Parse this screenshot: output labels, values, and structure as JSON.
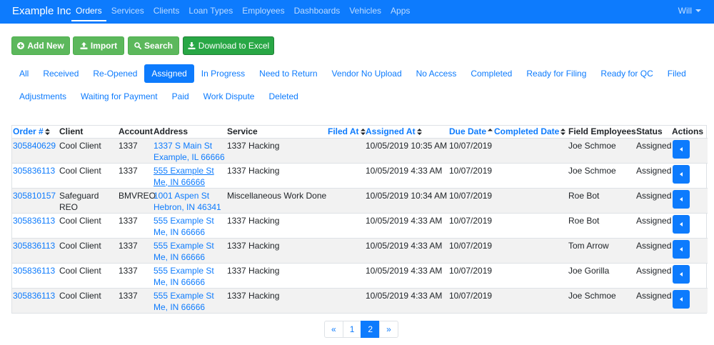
{
  "brand": "Example Inc",
  "nav": [
    "Orders",
    "Services",
    "Clients",
    "Loan Types",
    "Employees",
    "Dashboards",
    "Vehicles",
    "Apps"
  ],
  "nav_active": 0,
  "user": "Will",
  "toolbar": {
    "add_new": "Add New",
    "import": "Import",
    "search": "Search",
    "download": "Download to Excel"
  },
  "filters_row1": [
    "All",
    "Received",
    "Re-Opened",
    "Assigned",
    "In Progress",
    "Need to Return",
    "Vendor No Upload",
    "No Access",
    "Completed",
    "Ready for Filing",
    "Ready for QC",
    "Filed"
  ],
  "filters_row2": [
    "Adjustments",
    "Waiting for Payment",
    "Paid",
    "Work Dispute",
    "Deleted"
  ],
  "filter_active": "Assigned",
  "columns": {
    "order": "Order #",
    "client": "Client",
    "account": "Account",
    "address": "Address",
    "service": "Service",
    "filed_at": "Filed At",
    "assigned_at": "Assigned At",
    "due_date": "Due Date",
    "completed_date": "Completed Date",
    "field_employees": "Field Employees",
    "status": "Status",
    "actions": "Actions"
  },
  "rows": [
    {
      "order": "305840629",
      "client": "Cool Client",
      "account": "1337",
      "address1": "1337 S Main St",
      "address2": "Example, IL 66666",
      "service": "1337 Hacking",
      "filed_at": "",
      "assigned_at": "10/05/2019 10:35 AM",
      "due_date": "10/07/2019",
      "completed_date": "",
      "employee": "Joe Schmoe",
      "status": "Assigned"
    },
    {
      "order": "305836113",
      "client": "Cool Client",
      "account": "1337",
      "address1": "555 Example St",
      "address2": "Me, IN 66666",
      "service": "1337 Hacking",
      "filed_at": "",
      "assigned_at": "10/05/2019 4:33 AM",
      "due_date": "10/07/2019",
      "completed_date": "",
      "employee": "Joe Schmoe",
      "status": "Assigned"
    },
    {
      "order": "305810157",
      "client": "Safeguard REO",
      "account": "BMVREO",
      "address1": "1001 Aspen St",
      "address2": "Hebron, IN 46341",
      "service": "Miscellaneous Work Done",
      "filed_at": "",
      "assigned_at": "10/05/2019 10:34 AM",
      "due_date": "10/07/2019",
      "completed_date": "",
      "employee": "Roe Bot",
      "status": "Assigned"
    },
    {
      "order": "305836113",
      "client": "Cool Client",
      "account": "1337",
      "address1": "555 Example St",
      "address2": "Me, IN 66666",
      "service": "1337 Hacking",
      "filed_at": "",
      "assigned_at": "10/05/2019 4:33 AM",
      "due_date": "10/07/2019",
      "completed_date": "",
      "employee": "Roe Bot",
      "status": "Assigned"
    },
    {
      "order": "305836113",
      "client": "Cool Client",
      "account": "1337",
      "address1": "555 Example St",
      "address2": "Me, IN 66666",
      "service": "1337 Hacking",
      "filed_at": "",
      "assigned_at": "10/05/2019 4:33 AM",
      "due_date": "10/07/2019",
      "completed_date": "",
      "employee": "Tom Arrow",
      "status": "Assigned"
    },
    {
      "order": "305836113",
      "client": "Cool Client",
      "account": "1337",
      "address1": "555 Example St",
      "address2": "Me, IN 66666",
      "service": "1337 Hacking",
      "filed_at": "",
      "assigned_at": "10/05/2019 4:33 AM",
      "due_date": "10/07/2019",
      "completed_date": "",
      "employee": "Joe Gorilla",
      "status": "Assigned"
    },
    {
      "order": "305836113",
      "client": "Cool Client",
      "account": "1337",
      "address1": "555 Example St",
      "address2": "Me, IN 66666",
      "service": "1337 Hacking",
      "filed_at": "",
      "assigned_at": "10/05/2019 4:33 AM",
      "due_date": "10/07/2019",
      "completed_date": "",
      "employee": "Joe Schmoe",
      "status": "Assigned"
    }
  ],
  "pagination": {
    "prev": "«",
    "pages": [
      "1",
      "2"
    ],
    "active_page": "2",
    "next": "»"
  },
  "colors": {
    "primary": "#0d7bfd",
    "success_light": "#5cb85c",
    "success": "#28a745",
    "stripe": "#f2f2f2"
  }
}
